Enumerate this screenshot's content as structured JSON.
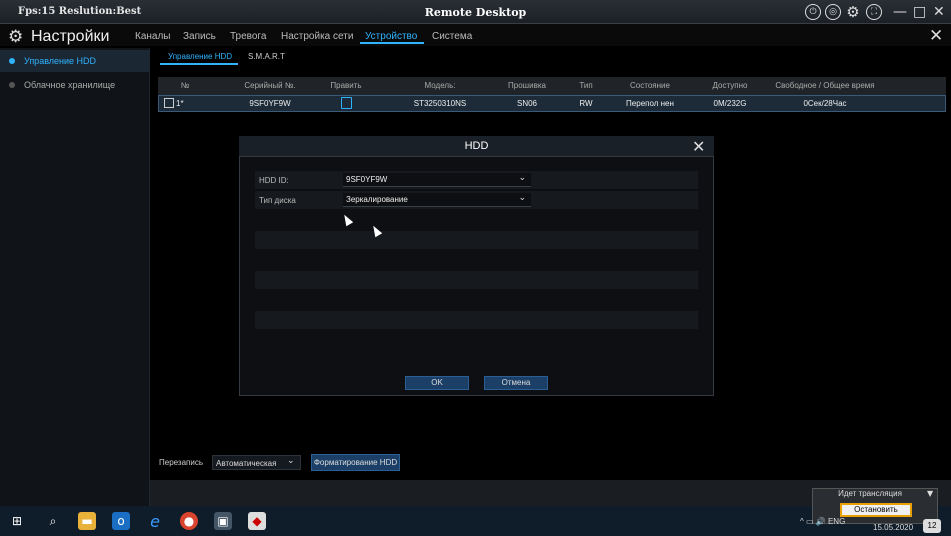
{
  "window": {
    "fps_text": "Fps:15 Reslution:Best",
    "title": "Remote Desktop",
    "min": "—",
    "max": "□",
    "close": "✕"
  },
  "app": {
    "title": "Настройки",
    "menu": [
      "Каналы",
      "Запись",
      "Тревога",
      "Настройка сети",
      "Устройство",
      "Система"
    ],
    "active_menu": "Устройство"
  },
  "sidebar": {
    "items": [
      {
        "label": "Управление HDD"
      },
      {
        "label": "Облачное хранилище"
      }
    ]
  },
  "subtabs": [
    "Управление HDD",
    "S.M.A.R.T"
  ],
  "table": {
    "headers": [
      "№",
      "Серийный №.",
      "Править",
      "Модель:",
      "Прошивка",
      "Тип",
      "Состояние",
      "Доступно",
      "Свободное / Общее время"
    ],
    "row": [
      "1*",
      "9SF0YF9W",
      "",
      "ST3250310NS",
      "SN06",
      "RW",
      "Перепол нен",
      "0M/232G",
      "0Сек/28Час"
    ]
  },
  "dialog": {
    "title": "HDD",
    "hdd_id_label": "HDD ID:",
    "hdd_id_value": "9SF0YF9W",
    "type_label": "Тип диска",
    "type_value": "Зеркалирование",
    "ok": "OK",
    "cancel": "Отмена"
  },
  "bottom": {
    "overwrite_label": "Перезапись",
    "overwrite_value": "Автоматическая",
    "format_btn": "Форматирование HDD"
  },
  "stream": {
    "status": "Идет трансляция",
    "stop": "Остановить"
  },
  "taskbar": {
    "lang": "ENG",
    "date": "15.05.2020",
    "notif": "12"
  },
  "colors": {
    "accent": "#2fb3ff",
    "button": "#1b3f66"
  }
}
